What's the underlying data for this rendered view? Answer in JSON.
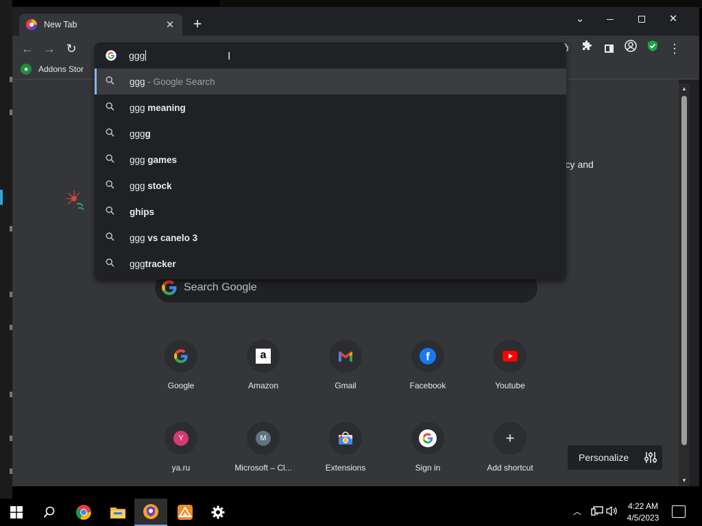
{
  "browser": {
    "tab_title": "New Tab",
    "tab_close": "✕",
    "new_tab": "+",
    "tab_search": "⌄",
    "close_window": "✕",
    "menu": "⋮"
  },
  "toolbar": {
    "back": "←",
    "forward": "→",
    "reload": "↻"
  },
  "bookmarks": {
    "addons_label": "Addons Stor"
  },
  "omnibox": {
    "input_value": "ggg",
    "suggestions": [
      {
        "prefix": "ggg",
        "bold": "",
        "desc": " - Google Search"
      },
      {
        "prefix": "ggg",
        "bold": " meaning",
        "desc": ""
      },
      {
        "prefix": "ggg",
        "bold": "g",
        "desc": ""
      },
      {
        "prefix": "ggg",
        "bold": " games",
        "desc": ""
      },
      {
        "prefix": "ggg",
        "bold": " stock",
        "desc": ""
      },
      {
        "prefix": "",
        "bold": "ghips",
        "desc": ""
      },
      {
        "prefix": "ggg",
        "bold": " vs canelo 3",
        "desc": ""
      },
      {
        "prefix": "ggg",
        "bold": "tracker",
        "desc": ""
      }
    ]
  },
  "newtab": {
    "privacy_fragment": "rivacy and",
    "search_placeholder": "Search Google",
    "shortcuts": [
      {
        "label": "Google"
      },
      {
        "label": "Amazon",
        "glyph": "a"
      },
      {
        "label": "Gmail"
      },
      {
        "label": "Facebook",
        "glyph": "f"
      },
      {
        "label": "Youtube"
      },
      {
        "label": "ya.ru",
        "glyph": "Y"
      },
      {
        "label": "Microsoft – Cl...",
        "glyph": "M"
      },
      {
        "label": "Extensions"
      },
      {
        "label": "Sign in"
      },
      {
        "label": "Add shortcut",
        "glyph": "+"
      }
    ],
    "personalize_label": "Personalize"
  },
  "taskbar": {
    "time": "4:22 AM",
    "date": "4/5/2023"
  },
  "colors": {
    "google_blue": "#4285F4",
    "google_red": "#EA4335",
    "google_yellow": "#FBBC05",
    "google_green": "#34A853"
  }
}
